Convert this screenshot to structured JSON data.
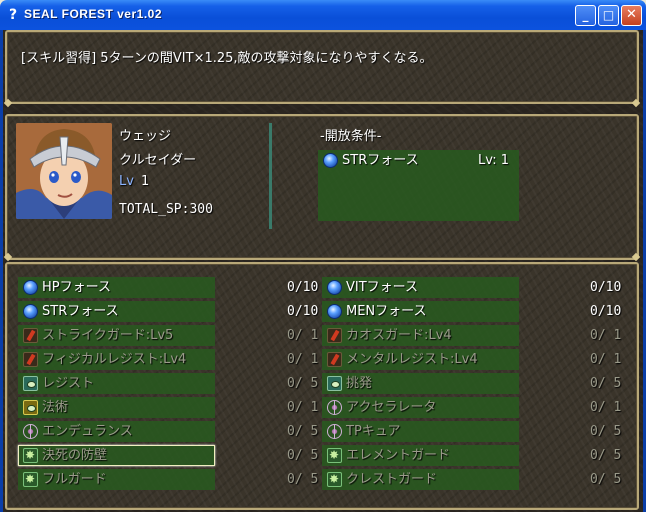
{
  "window": {
    "title": "SEAL FOREST ver1.02",
    "minimize": "_",
    "maximize": "□",
    "close": "✕"
  },
  "help": {
    "text": "[スキル習得] 5ターンの間VIT×1.25,敵の攻撃対象になりやすくなる。"
  },
  "character": {
    "name": "ウェッジ",
    "class": "クルセイダー",
    "lv_label": "Lv",
    "lv_value": "1",
    "total_sp": "TOTAL_SP:300"
  },
  "unlock": {
    "header": "-開放条件-",
    "requirement_name": "STRフォース",
    "requirement_lv": "Lv: 1"
  },
  "skills_left": [
    {
      "name": "HPフォース",
      "value": "0/10",
      "icon": "orb",
      "enabled": true
    },
    {
      "name": "STRフォース",
      "value": "0/10",
      "icon": "orb",
      "enabled": true
    },
    {
      "name": "ストライクガード:Lv5",
      "value": "0/ 1",
      "icon": "shield",
      "enabled": false
    },
    {
      "name": "フィジカルレジスト:Lv4",
      "value": "0/ 1",
      "icon": "shield",
      "enabled": false
    },
    {
      "name": "レジスト",
      "value": "0/ 5",
      "icon": "eye",
      "enabled": false
    },
    {
      "name": "法術",
      "value": "0/ 1",
      "icon": "eye-gold",
      "enabled": false
    },
    {
      "name": "エンデュランス",
      "value": "0/ 5",
      "icon": "target",
      "enabled": false
    },
    {
      "name": "決死の防壁",
      "value": "0/ 5",
      "icon": "star",
      "enabled": false
    },
    {
      "name": "フルガード",
      "value": "0/ 5",
      "icon": "star",
      "enabled": false
    }
  ],
  "skills_right": [
    {
      "name": "VITフォース",
      "value": "0/10",
      "icon": "orb",
      "enabled": true
    },
    {
      "name": "MENフォース",
      "value": "0/10",
      "icon": "orb",
      "enabled": true
    },
    {
      "name": "カオスガード:Lv4",
      "value": "0/ 1",
      "icon": "shield",
      "enabled": false
    },
    {
      "name": "メンタルレジスト:Lv4",
      "value": "0/ 1",
      "icon": "shield",
      "enabled": false
    },
    {
      "name": "挑発",
      "value": "0/ 5",
      "icon": "eye",
      "enabled": false
    },
    {
      "name": "アクセラレータ",
      "value": "0/ 1",
      "icon": "target",
      "enabled": false
    },
    {
      "name": "TPキュア",
      "value": "0/ 5",
      "icon": "target",
      "enabled": false
    },
    {
      "name": "エレメントガード",
      "value": "0/ 5",
      "icon": "star",
      "enabled": false
    },
    {
      "name": "クレストガード",
      "value": "0/ 5",
      "icon": "star",
      "enabled": false
    }
  ],
  "selected": {
    "column": "left",
    "index": 7
  }
}
